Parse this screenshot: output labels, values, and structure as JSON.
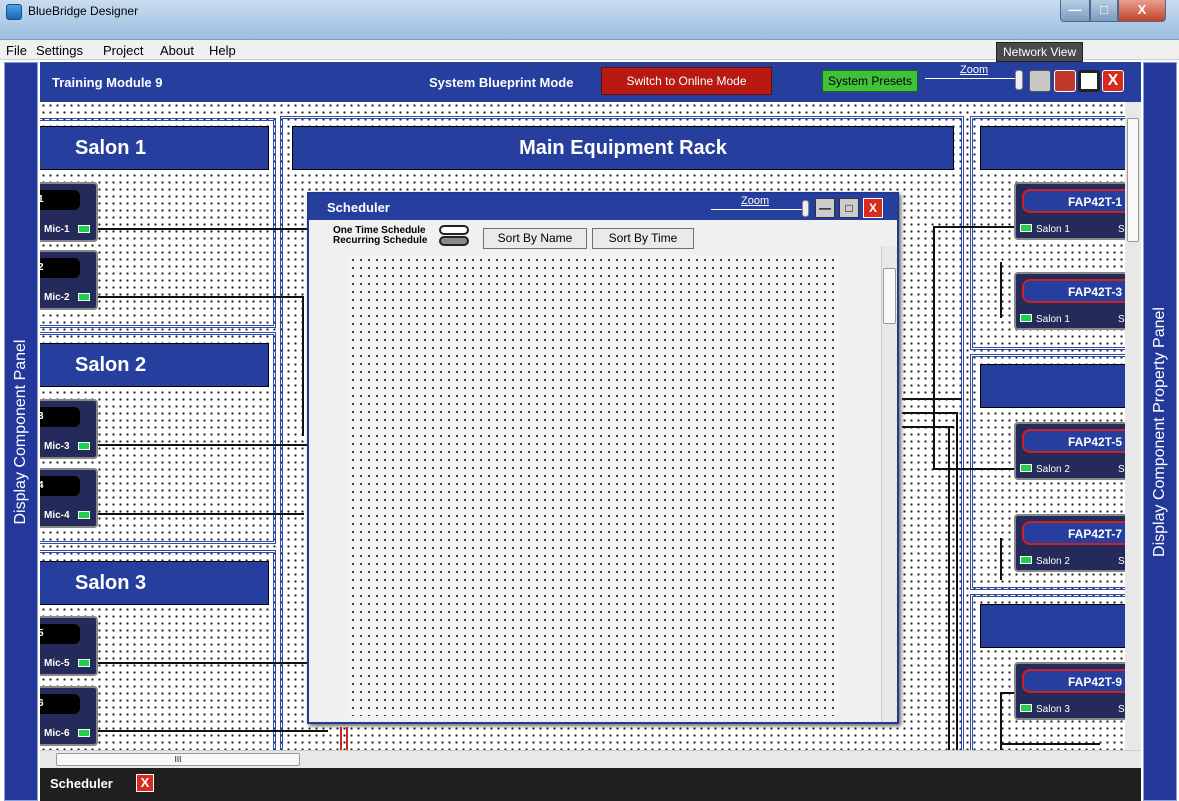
{
  "window": {
    "title": "BlueBridge Designer",
    "min": "—",
    "max": "□",
    "close": "X"
  },
  "menu": [
    "File",
    "Settings",
    "Project",
    "About",
    "Help"
  ],
  "network_view": "Network View",
  "side_panels": {
    "left": "Display Component Panel",
    "right": "Display Component Property Panel"
  },
  "header": {
    "module": "Training Module 9",
    "mode": "System Blueprint Mode",
    "online_button": "Switch to Online Mode",
    "presets_button": "System Presets",
    "zoom_label": "Zoom",
    "close": "X"
  },
  "zones": {
    "salon1": "Salon 1",
    "salon2": "Salon 2",
    "salon3": "Salon 3",
    "rack": "Main Equipment Rack"
  },
  "mics": [
    {
      "label": "Mic-1",
      "cap": "1"
    },
    {
      "label": "Mic-2",
      "cap": "2"
    },
    {
      "label": "Mic-3",
      "cap": "3"
    },
    {
      "label": "Mic-4",
      "cap": "4"
    },
    {
      "label": "Mic-5",
      "cap": "5"
    },
    {
      "label": "Mic-6",
      "cap": "6"
    }
  ],
  "amps": [
    {
      "name": "FAP42T-1",
      "zone": "Salon 1",
      "suffix": "S"
    },
    {
      "name": "FAP42T-3",
      "zone": "Salon 1",
      "suffix": "S"
    },
    {
      "name": "FAP42T-5",
      "zone": "Salon 2",
      "suffix": "S"
    },
    {
      "name": "FAP42T-7",
      "zone": "Salon 2",
      "suffix": "S"
    },
    {
      "name": "FAP42T-9",
      "zone": "Salon 3",
      "suffix": "S"
    }
  ],
  "scheduler": {
    "title": "Scheduler",
    "zoom_label": "Zoom",
    "one_time": "One Time Schedule",
    "recurring": "Recurring Schedule",
    "sort_name": "Sort By Name",
    "sort_time": "Sort By Time",
    "min": "—",
    "max": "□",
    "close": "X"
  },
  "hscroll_grip": "III",
  "taskbar": {
    "label": "Scheduler",
    "close": "X"
  }
}
